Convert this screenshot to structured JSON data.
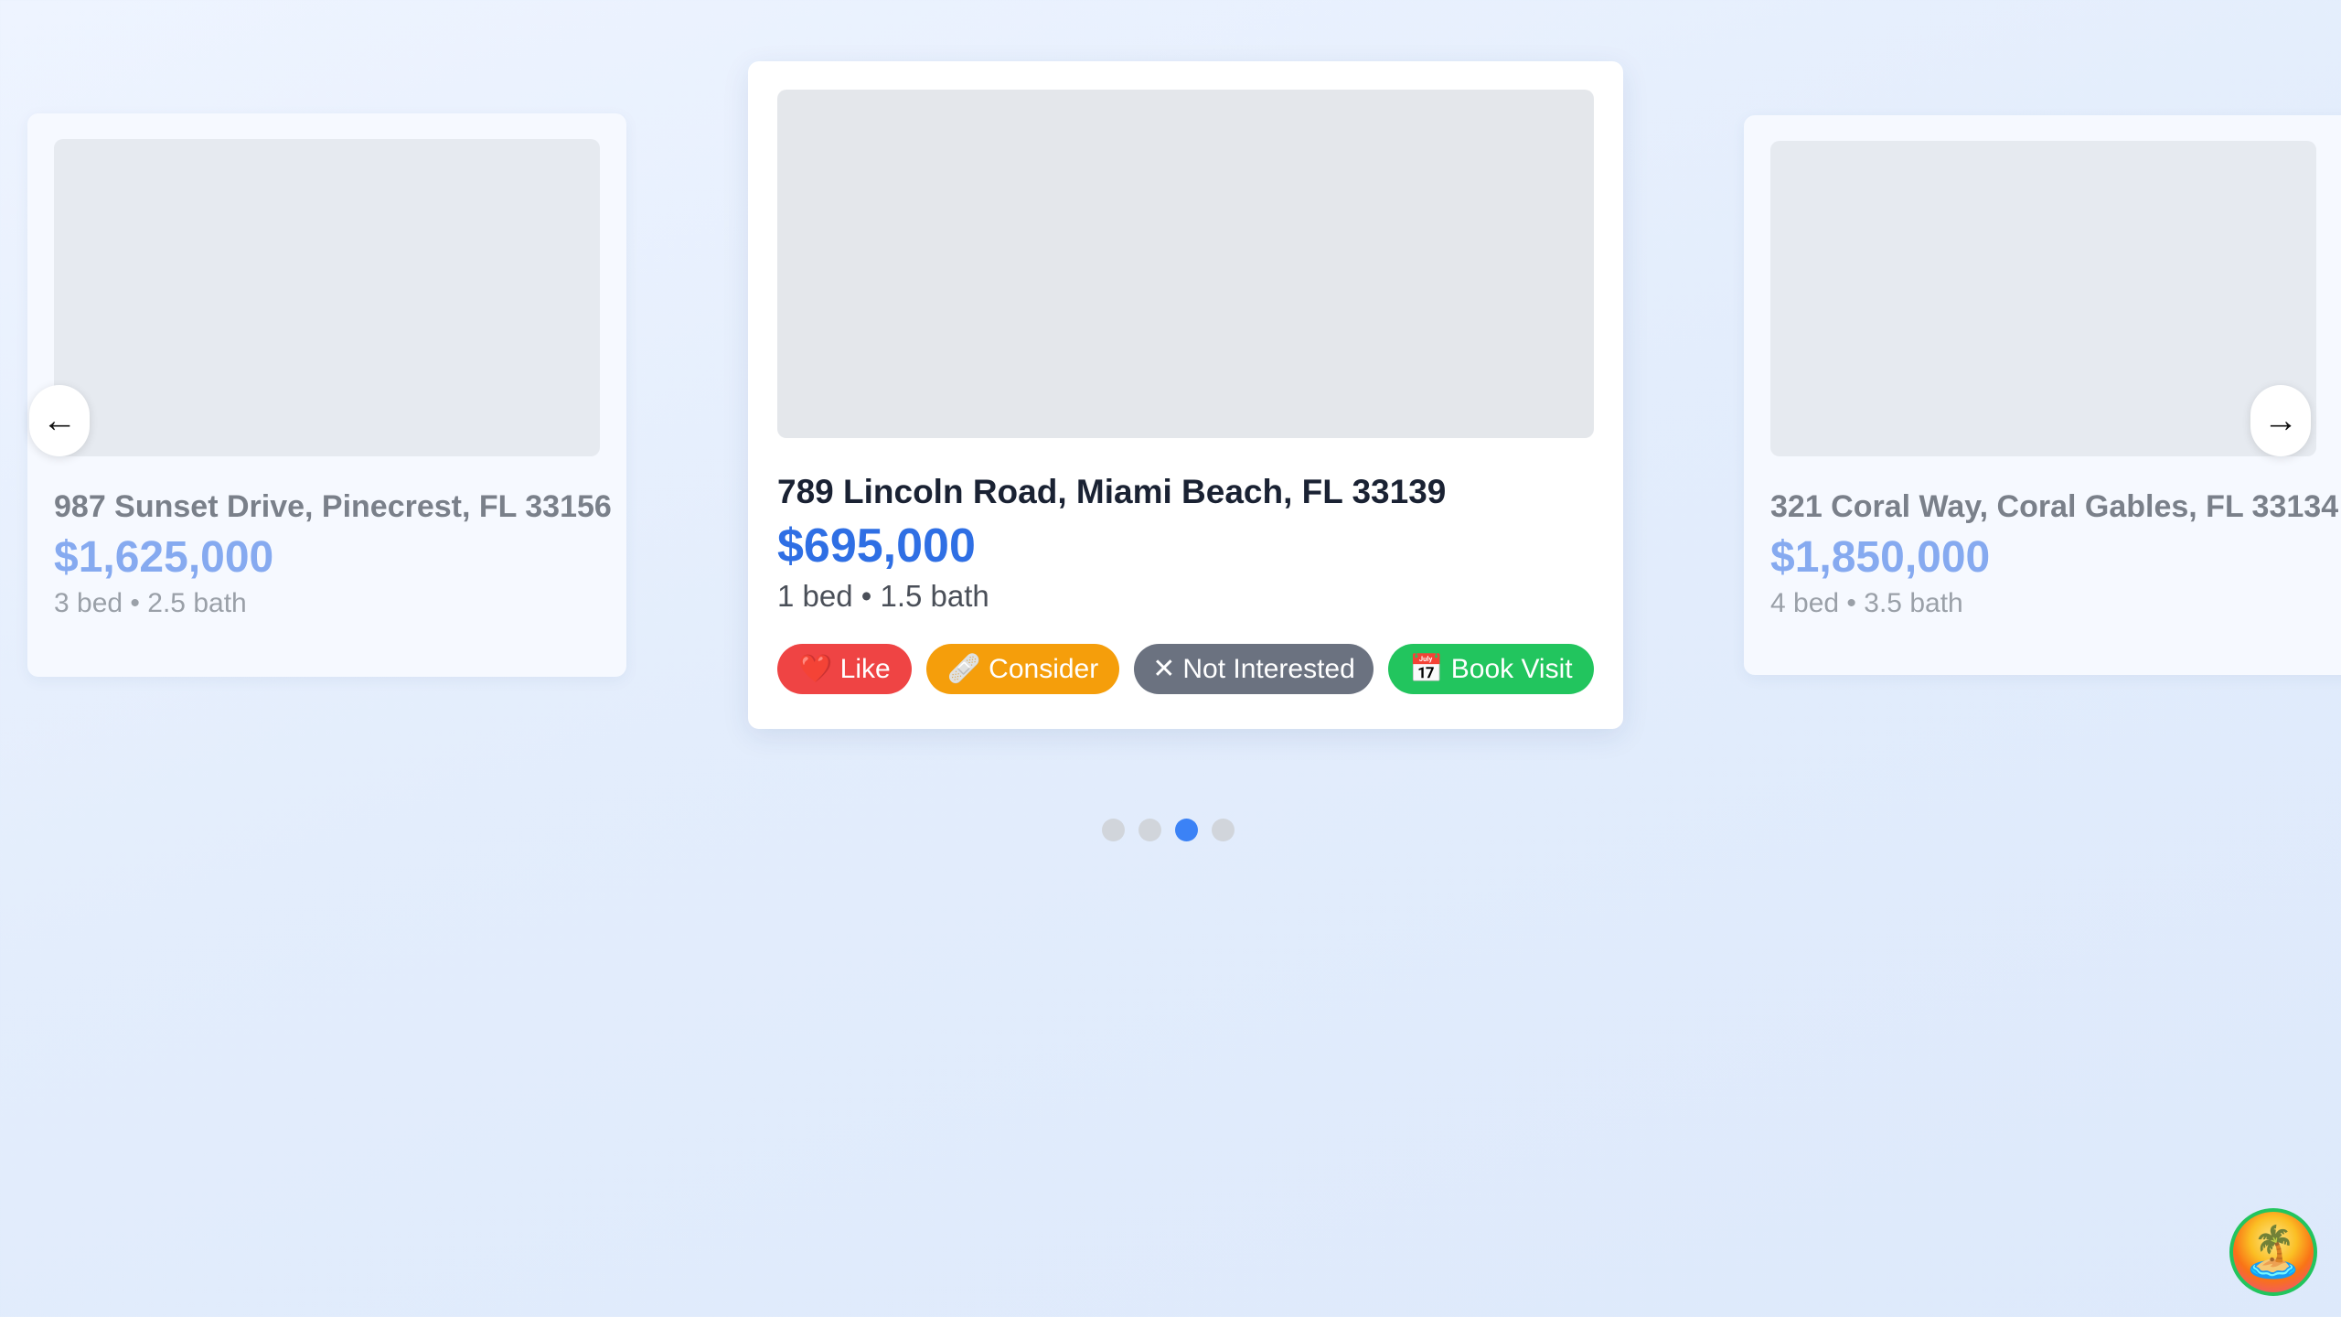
{
  "listings": {
    "left": {
      "address": "987 Sunset Drive, Pinecrest, FL 33156",
      "price": "$1,625,000",
      "beds": "3 bed",
      "separator": "•",
      "baths": "2.5 bath"
    },
    "center": {
      "address": "789 Lincoln Road, Miami Beach, FL 33139",
      "price": "$695,000",
      "beds": "1 bed",
      "separator": "•",
      "baths": "1.5 bath"
    },
    "right": {
      "address": "321 Coral Way, Coral Gables, FL 33134",
      "price": "$1,850,000",
      "beds": "4 bed",
      "separator": "•",
      "baths": "3.5 bath"
    }
  },
  "actions": {
    "like": {
      "icon": "❤️",
      "label": "Like"
    },
    "consider": {
      "icon": "🩹",
      "label": "Consider"
    },
    "not_interested": {
      "icon": "✕",
      "label": "Not Interested"
    },
    "book_visit": {
      "icon": "📅",
      "label": "Book Visit"
    }
  },
  "navigation": {
    "prev_icon": "←",
    "next_icon": "→"
  },
  "pagination": {
    "total": 4,
    "active_index": 2
  },
  "avatar": {
    "icon": "🏝️"
  },
  "colors": {
    "accent": "#3b82f6",
    "like": "#ef4444",
    "consider": "#f59e0b",
    "not_interested": "#6b7280",
    "book_visit": "#22c55e"
  }
}
